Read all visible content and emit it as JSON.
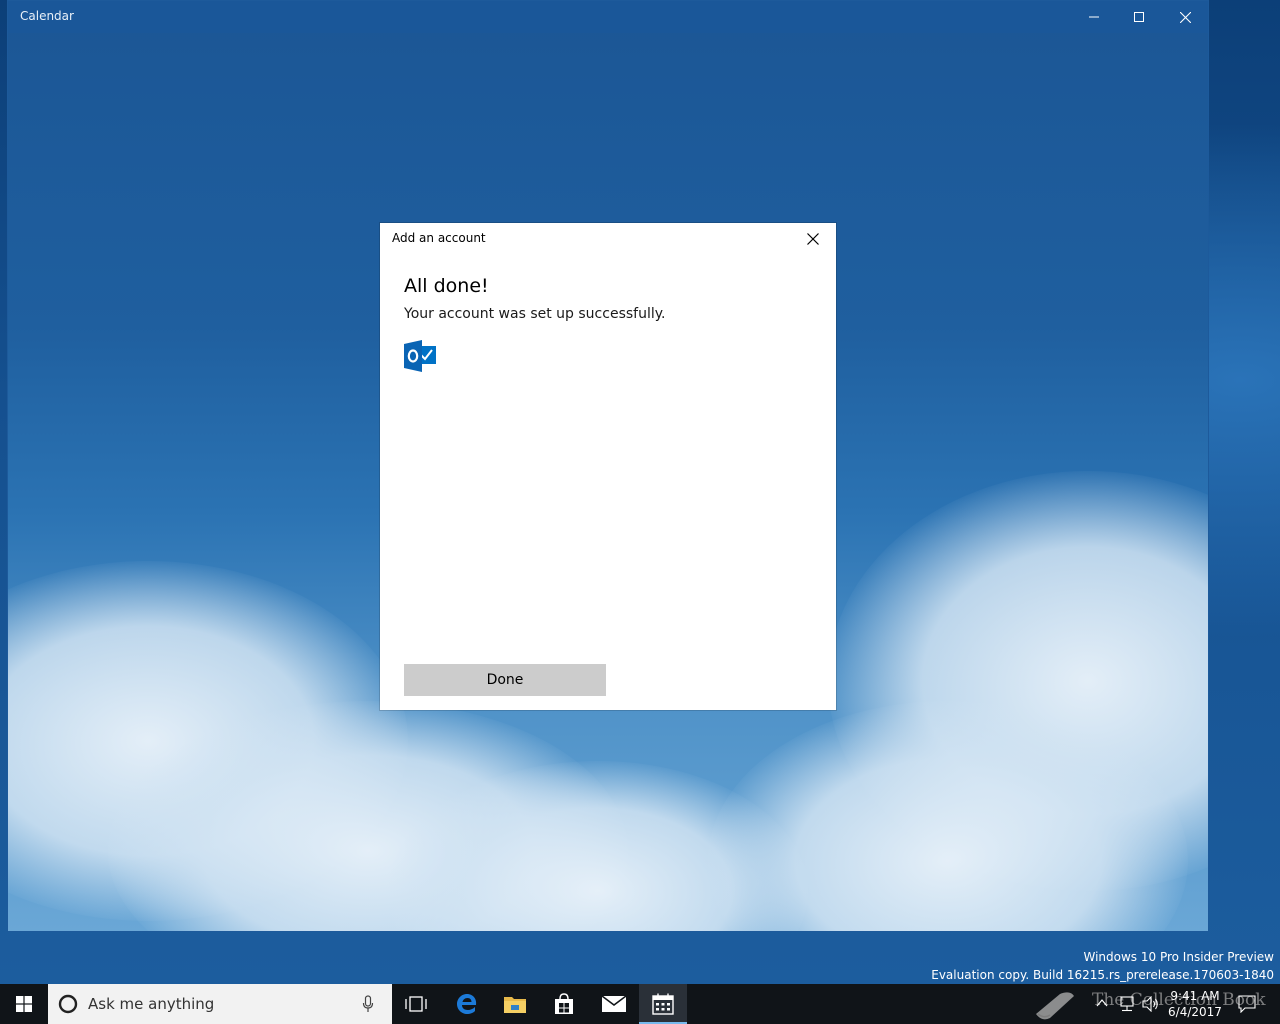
{
  "window": {
    "title": "Calendar"
  },
  "dialog": {
    "title": "Add an account",
    "heading": "All done!",
    "message": "Your account was set up successfully.",
    "done_label": "Done",
    "account_icon": "outlook-icon"
  },
  "watermark": {
    "line1": "Windows 10 Pro Insider Preview",
    "line2": "Evaluation copy. Build 16215.rs_prerelease.170603-1840"
  },
  "taskbar": {
    "search_placeholder": "Ask me anything",
    "pinned": [
      "task-view-icon",
      "edge-icon",
      "file-explorer-icon",
      "store-icon",
      "mail-icon",
      "calendar-icon"
    ],
    "active_app": "calendar-icon",
    "clock_time": "9:41 AM",
    "clock_date": "6/4/2017",
    "overlay_logo_text": "The Collection Book"
  },
  "colors": {
    "titlebar": "#1a5799",
    "taskbar": "#101418",
    "accent": "#0072c6",
    "done_button": "#cccccc"
  }
}
